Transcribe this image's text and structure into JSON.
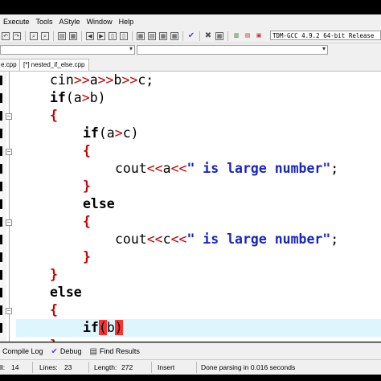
{
  "menu": [
    "Execute",
    "Tools",
    "AStyle",
    "Window",
    "Help"
  ],
  "toolbar": {
    "compiler": "TDM-GCC 4.9.2 64-bit Release"
  },
  "tabs": [
    {
      "label": "e.cpp",
      "active": false
    },
    {
      "label": "[*] nested_if_else.cpp",
      "active": true
    }
  ],
  "code": {
    "l1": {
      "a": "cin",
      "b": ">>",
      "c": "a",
      "d": ">>",
      "e": "b",
      "f": ">>",
      "g": "c;"
    },
    "l2": {
      "kw": "if",
      "a": "(a",
      "op": ">",
      "b": "b)"
    },
    "l3": {
      "br": "{"
    },
    "l4": {
      "kw": "if",
      "a": "(a",
      "op": ">",
      "b": "c)"
    },
    "l5": {
      "br": "{"
    },
    "l6": {
      "a": "cout",
      "op": "<<",
      "b": "a",
      "op2": "<<",
      "str": "\" is large number\"",
      "end": ";"
    },
    "l7": {
      "br": "}"
    },
    "l8": {
      "kw": "else"
    },
    "l9": {
      "br": "{"
    },
    "l10": {
      "a": "cout",
      "op": "<<",
      "b": "c",
      "op2": "<<",
      "str": "\" is large number\"",
      "end": ";"
    },
    "l11": {
      "br": "}"
    },
    "l12": {
      "br": "}"
    },
    "l13": {
      "kw": "else"
    },
    "l14": {
      "br": "{"
    },
    "l15": {
      "kw": "if",
      "p1": "(",
      "b": "b",
      "p2": ")"
    },
    "l16": {
      "br": "}"
    }
  },
  "bottom_tabs": [
    {
      "label": "Compile Log",
      "icon": "compile-log-icon"
    },
    {
      "label": "Debug",
      "icon": "check-icon"
    },
    {
      "label": "Find Results",
      "icon": "find-results-icon"
    }
  ],
  "status": {
    "col_label": "ll:",
    "col_value": "14",
    "lines_label": "Lines:",
    "lines_value": "23",
    "length_label": "Length:",
    "length_value": "272",
    "mode": "Insert",
    "message": "Done parsing in 0.016 seconds"
  },
  "colors": {
    "keyword": "#000000",
    "operator": "#c80000",
    "string": "#1624c4",
    "current_line": "#ddf6fd",
    "brace_match": "#ff3030"
  }
}
